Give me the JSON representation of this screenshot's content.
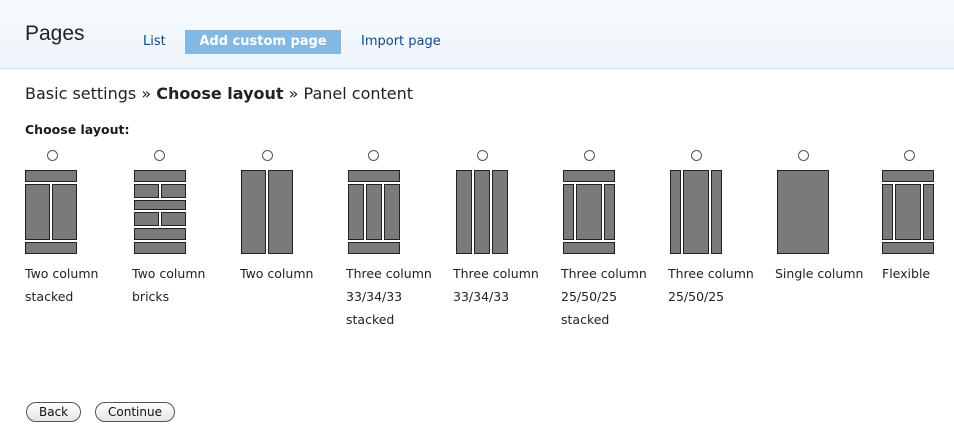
{
  "header": {
    "title": "Pages",
    "tabs": [
      {
        "label": "List"
      },
      {
        "label": "Add custom page"
      },
      {
        "label": "Import page"
      }
    ]
  },
  "breadcrumb": {
    "step1": "Basic settings",
    "separator": "»",
    "step2": "Choose layout",
    "step3": "Panel content"
  },
  "form": {
    "label": "Choose layout:",
    "layouts": [
      {
        "name": "Two column stacked",
        "lines": [
          "Two column",
          "stacked"
        ]
      },
      {
        "name": "Two column bricks",
        "lines": [
          "Two column",
          "bricks"
        ]
      },
      {
        "name": "Two column",
        "lines": [
          "Two column"
        ]
      },
      {
        "name": "Three column 33/34/33 stacked",
        "lines": [
          "Three column",
          "33/34/33",
          "stacked"
        ]
      },
      {
        "name": "Three column 33/34/33",
        "lines": [
          "Three column",
          "33/34/33"
        ]
      },
      {
        "name": "Three column 25/50/25 stacked",
        "lines": [
          "Three column",
          "25/50/25",
          "stacked"
        ]
      },
      {
        "name": "Three column 25/50/25",
        "lines": [
          "Three column",
          "25/50/25"
        ]
      },
      {
        "name": "Single column",
        "lines": [
          "Single column"
        ]
      },
      {
        "name": "Flexible",
        "lines": [
          "Flexible"
        ]
      }
    ]
  },
  "buttons": {
    "back": "Back",
    "continue": "Continue"
  }
}
